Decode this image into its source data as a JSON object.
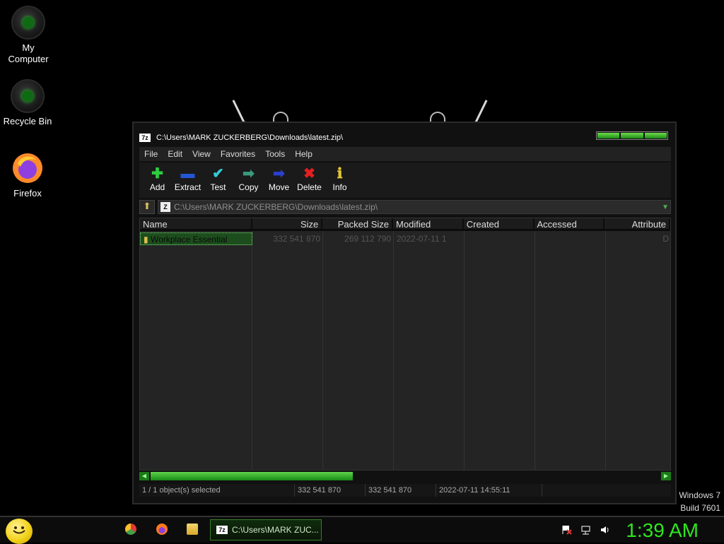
{
  "desktop": {
    "icons": [
      {
        "label_line1": "My",
        "label_line2": "Computer"
      },
      {
        "label": "Recycle Bin"
      },
      {
        "label": "Firefox"
      }
    ],
    "watermark": {
      "line1": "Windows 7",
      "line2": "Build 7601"
    }
  },
  "window": {
    "title": "C:\\Users\\MARK ZUCKERBERG\\Downloads\\latest.zip\\",
    "app_badge": "7z",
    "menu": [
      "File",
      "Edit",
      "View",
      "Favorites",
      "Tools",
      "Help"
    ],
    "toolbar": [
      {
        "label": "Add",
        "icon": "plus-icon",
        "glyph": "✚",
        "color": "#2ecb3f"
      },
      {
        "label": "Extract",
        "icon": "minus-icon",
        "glyph": "▬",
        "color": "#2455d5"
      },
      {
        "label": "Test",
        "icon": "check-icon",
        "glyph": "✔",
        "color": "#33c9d8"
      },
      {
        "label": "Copy",
        "icon": "copy-arrow-icon",
        "glyph": "➡",
        "color": "#3a9a7c"
      },
      {
        "label": "Move",
        "icon": "move-arrow-icon",
        "glyph": "➡",
        "color": "#2a3fd0"
      },
      {
        "label": "Delete",
        "icon": "delete-x-icon",
        "glyph": "✖",
        "color": "#e12020"
      },
      {
        "label": "Info",
        "icon": "info-icon",
        "glyph": "ℹ",
        "color": "#e7c830"
      }
    ],
    "address": "C:\\Users\\MARK ZUCKERBERG\\Downloads\\latest.zip\\",
    "columns": [
      "Name",
      "Size",
      "Packed Size",
      "Modified",
      "Created",
      "Accessed",
      "Attribute"
    ],
    "rows": [
      {
        "name": "Workplace Essential",
        "size": "332 541 870",
        "packed": "269 112 790",
        "modified": "2022-07-11 1",
        "created": "",
        "accessed": "",
        "attribute": "D"
      }
    ],
    "status": {
      "selected": "1 / 1 object(s) selected",
      "size": "332 541 870",
      "packed": "332 541 870",
      "modified": "2022-07-11 14:55:11"
    }
  },
  "taskbar": {
    "task_title": "C:\\Users\\MARK ZUC...",
    "clock": "1:39 AM"
  },
  "colors": {
    "accent": "#2ee51f",
    "window_bg": "#242424"
  }
}
